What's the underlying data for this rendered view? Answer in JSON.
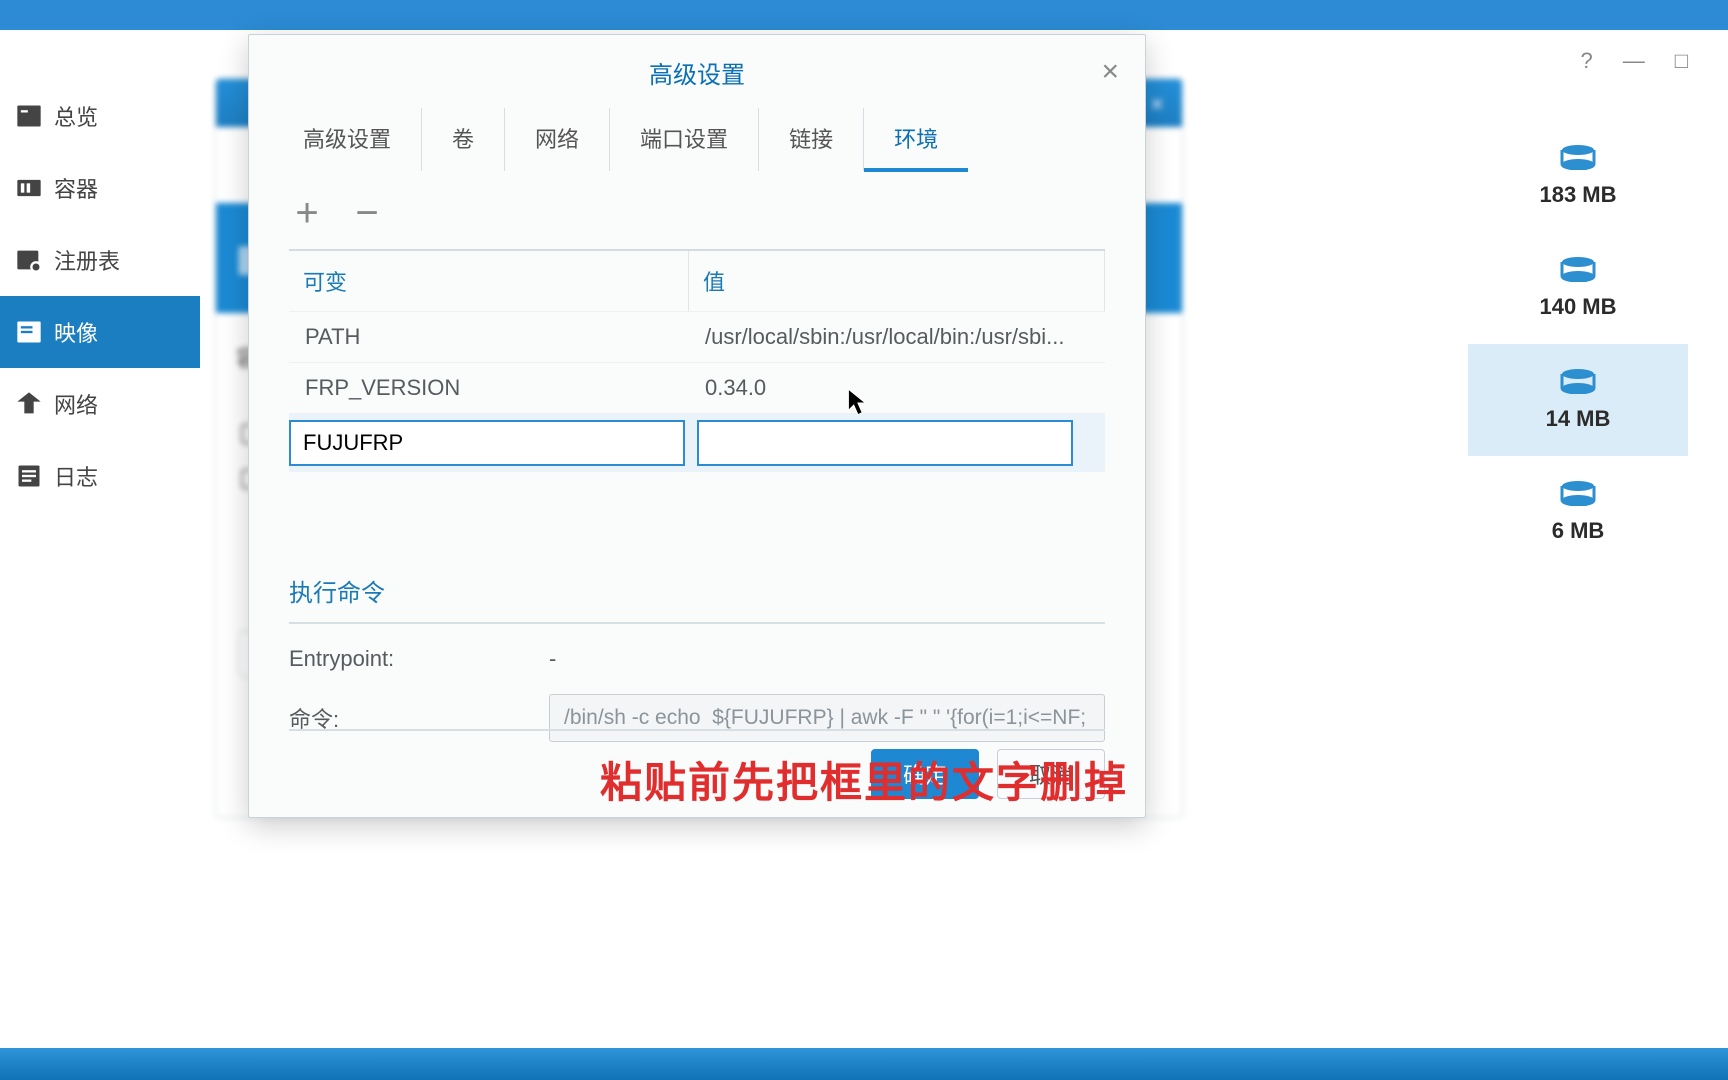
{
  "win_controls": {
    "help": "?",
    "min": "—",
    "max": "□"
  },
  "sidebar": {
    "items": [
      {
        "label": "总览"
      },
      {
        "label": "容器"
      },
      {
        "label": "注册表"
      },
      {
        "label": "映像"
      },
      {
        "label": "网络"
      },
      {
        "label": "日志"
      }
    ]
  },
  "bg_window": {
    "label_container": "容",
    "close": "×"
  },
  "image_list": [
    {
      "size": "183 MB"
    },
    {
      "size": "140 MB"
    },
    {
      "size": "14 MB"
    },
    {
      "size": "6 MB"
    }
  ],
  "modal": {
    "title": "高级设置",
    "close": "×",
    "tabs": [
      "高级设置",
      "卷",
      "网络",
      "端口设置",
      "链接",
      "环境"
    ],
    "active_tab": 5,
    "env": {
      "header_key": "可变",
      "header_val": "值",
      "rows": [
        {
          "key": "PATH",
          "val": "/usr/local/sbin:/usr/local/bin:/usr/sbi..."
        },
        {
          "key": "FRP_VERSION",
          "val": "0.34.0"
        }
      ],
      "editing": {
        "key": "FUJUFRP",
        "val": ""
      }
    },
    "exec": {
      "title": "执行命令",
      "entrypoint_label": "Entrypoint:",
      "entrypoint_val": "-",
      "cmd_label": "命令:",
      "cmd_val": "/bin/sh -c echo  ${FUJUFRP} | awk -F \" \" '{for(i=1;i<=NF;"
    },
    "buttons": {
      "ok": "确定",
      "cancel": "取消"
    }
  },
  "subtitle": "粘贴前先把框里的文字删掉"
}
